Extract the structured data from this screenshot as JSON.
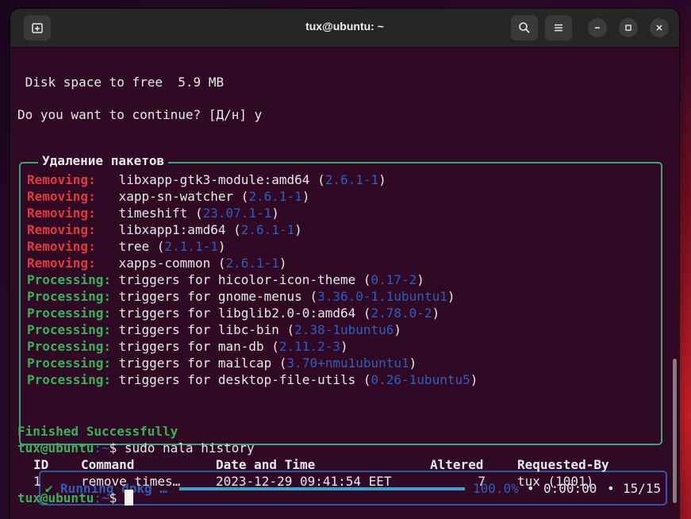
{
  "window": {
    "title": "tux@ubuntu: ~"
  },
  "titlebar_icons": {
    "new_tab": "new-tab-icon",
    "search": "search-icon",
    "menu": "hamburger-menu-icon",
    "minimize": "minimize-icon",
    "maximize": "maximize-icon",
    "close": "close-icon"
  },
  "terminal": {
    "disk_line": " Disk space to free  5.9 MB",
    "confirm_line": "Do you want to continue? [Д/н] y",
    "panel_title": "Удаление пакетов",
    "remove_label": "Removing:",
    "process_label": "Processing:",
    "removals": [
      {
        "pkg": "libxapp-gtk3-module:amd64",
        "ver": "2.6.1-1"
      },
      {
        "pkg": "xapp-sn-watcher",
        "ver": "2.6.1-1"
      },
      {
        "pkg": "timeshift",
        "ver": "23.07.1-1"
      },
      {
        "pkg": "libxapp1:amd64",
        "ver": "2.6.1-1"
      },
      {
        "pkg": "tree",
        "ver": "2.1.1-1"
      },
      {
        "pkg": "xapps-common",
        "ver": "2.6.1-1"
      }
    ],
    "triggers_prefix": "triggers for",
    "triggers": [
      {
        "pkg": "hicolor-icon-theme",
        "ver": "0.17-2"
      },
      {
        "pkg": "gnome-menus",
        "ver": "3.36.0-1.1ubuntu1"
      },
      {
        "pkg": "libglib2.0-0:amd64",
        "ver": "2.78.0-2"
      },
      {
        "pkg": "libc-bin",
        "ver": "2.38-1ubuntu6"
      },
      {
        "pkg": "man-db",
        "ver": "2.11.2-3"
      },
      {
        "pkg": "mailcap",
        "ver": "3.70+nmu1ubuntu1"
      },
      {
        "pkg": "desktop-file-utils",
        "ver": "0.26-1ubuntu5"
      }
    ],
    "progress": {
      "check": "✔",
      "label": "Running dpkg …",
      "percent_text": "100.0%",
      "fraction": 1.0,
      "elapsed": "0:00:00",
      "count": "15/15"
    },
    "finished": "Finished Successfully",
    "prompt_user": "tux@ubuntu",
    "prompt_path": ":~",
    "prompt_symbol": "$",
    "command": " sudo nala history",
    "history": {
      "headers": [
        "ID",
        "Command",
        "Date and Time",
        "Altered",
        "Requested-By"
      ],
      "rows": [
        [
          "1",
          "remove times…",
          "2023-12-29 09:41:54 EET",
          "7",
          "tux (1001)"
        ]
      ]
    }
  },
  "colors": {
    "terminal_bg": "#300a24",
    "removing": "#e03a3a",
    "processing": "#35b35a",
    "version": "#2e5db8",
    "panel_border": "#3ba57a",
    "progress_border": "#2c5aa0",
    "progress_fill": "#3ca0c8"
  }
}
